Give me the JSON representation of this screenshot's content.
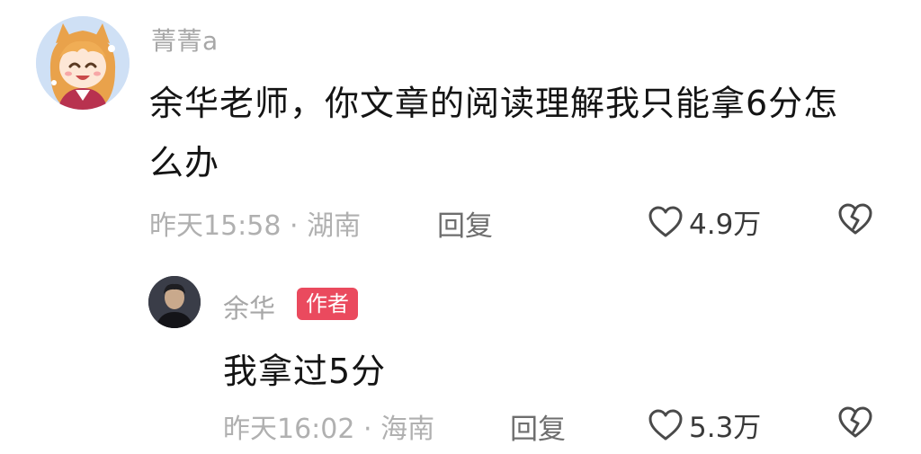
{
  "comment": {
    "username": "菁菁a",
    "text": "余华老师，你文章的阅读理解我只能拿6分怎么办",
    "time": "昨天15:58",
    "location": "湖南",
    "reply_label": "回复",
    "likes": "4.9万",
    "icons": {
      "avatar": "anime-girl-avatar",
      "like": "heart-outline-icon",
      "dislike": "broken-heart-icon"
    }
  },
  "reply": {
    "username": "余华",
    "badge": "作者",
    "text": "我拿过5分",
    "time": "昨天16:02",
    "location": "海南",
    "reply_label": "回复",
    "likes": "5.3万",
    "icons": {
      "avatar": "man-portrait-avatar",
      "like": "heart-outline-icon",
      "dislike": "broken-heart-icon"
    }
  },
  "colors": {
    "badge": "#ea4a5e",
    "muted_text": "#a7a7a7",
    "body_text": "#141414"
  }
}
